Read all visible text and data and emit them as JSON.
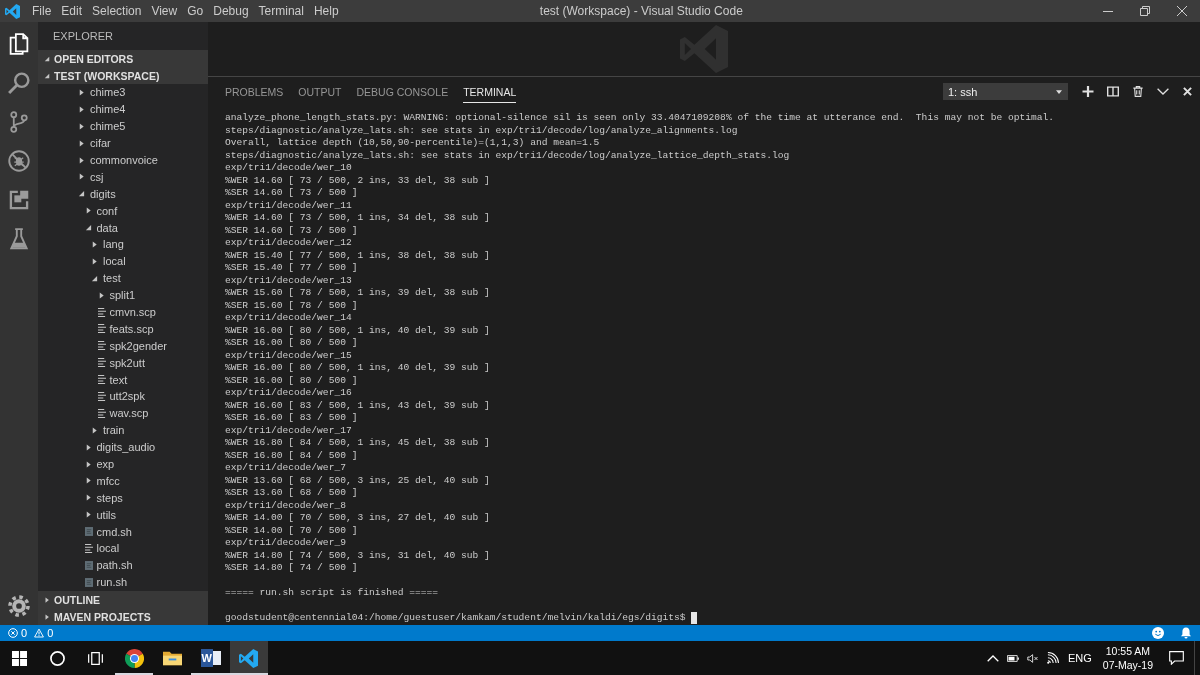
{
  "title_bar": {
    "menu": [
      "File",
      "Edit",
      "Selection",
      "View",
      "Go",
      "Debug",
      "Terminal",
      "Help"
    ],
    "title": "test (Workspace) - Visual Studio Code"
  },
  "activity_bar": {
    "items": [
      {
        "kind": "files",
        "selected": true
      },
      {
        "kind": "search",
        "selected": false
      },
      {
        "kind": "source-control",
        "selected": false
      },
      {
        "kind": "debug",
        "selected": false
      },
      {
        "kind": "extensions",
        "selected": false
      },
      {
        "kind": "test",
        "selected": false
      }
    ]
  },
  "sidebar": {
    "title": "EXPLORER",
    "sections": [
      {
        "title": "OPEN EDITORS",
        "expanded": true
      },
      {
        "title": "TEST (WORKSPACE)",
        "expanded": true,
        "tree": [
          {
            "name": "chime3",
            "kind": "folder",
            "expanded": false
          },
          {
            "name": "chime4",
            "kind": "folder",
            "expanded": false
          },
          {
            "name": "chime5",
            "kind": "folder",
            "expanded": false
          },
          {
            "name": "cifar",
            "kind": "folder",
            "expanded": false
          },
          {
            "name": "commonvoice",
            "kind": "folder",
            "expanded": false
          },
          {
            "name": "csj",
            "kind": "folder",
            "expanded": false
          },
          {
            "name": "digits",
            "kind": "folder",
            "expanded": true,
            "children": [
              {
                "name": "conf",
                "kind": "folder",
                "expanded": false
              },
              {
                "name": "data",
                "kind": "folder",
                "expanded": true,
                "children": [
                  {
                    "name": "lang",
                    "kind": "folder",
                    "expanded": false
                  },
                  {
                    "name": "local",
                    "kind": "folder",
                    "expanded": false
                  },
                  {
                    "name": "test",
                    "kind": "folder",
                    "expanded": true,
                    "children": [
                      {
                        "name": "split1",
                        "kind": "folder",
                        "expanded": false
                      },
                      {
                        "name": "cmvn.scp",
                        "kind": "text"
                      },
                      {
                        "name": "feats.scp",
                        "kind": "text"
                      },
                      {
                        "name": "spk2gender",
                        "kind": "text"
                      },
                      {
                        "name": "spk2utt",
                        "kind": "text"
                      },
                      {
                        "name": "text",
                        "kind": "text"
                      },
                      {
                        "name": "utt2spk",
                        "kind": "text"
                      },
                      {
                        "name": "wav.scp",
                        "kind": "text"
                      }
                    ]
                  },
                  {
                    "name": "train",
                    "kind": "folder",
                    "expanded": false
                  }
                ]
              },
              {
                "name": "digits_audio",
                "kind": "folder",
                "expanded": false
              },
              {
                "name": "exp",
                "kind": "folder",
                "expanded": false
              },
              {
                "name": "mfcc",
                "kind": "folder",
                "expanded": false
              },
              {
                "name": "steps",
                "kind": "folder",
                "expanded": false
              },
              {
                "name": "utils",
                "kind": "folder",
                "expanded": false
              },
              {
                "name": "cmd.sh",
                "kind": "script"
              },
              {
                "name": "local",
                "kind": "text"
              },
              {
                "name": "path.sh",
                "kind": "script"
              },
              {
                "name": "run.sh",
                "kind": "script"
              }
            ]
          }
        ]
      },
      {
        "title": "OUTLINE",
        "expanded": false
      },
      {
        "title": "MAVEN PROJECTS",
        "expanded": false
      }
    ]
  },
  "panel": {
    "tabs": [
      {
        "label": "PROBLEMS",
        "selected": false
      },
      {
        "label": "OUTPUT",
        "selected": false
      },
      {
        "label": "DEBUG CONSOLE",
        "selected": false
      },
      {
        "label": "TERMINAL",
        "selected": true
      }
    ],
    "terminal_select": {
      "value": "1: ssh"
    },
    "terminal": {
      "lines": [
        "analyze_phone_length_stats.py: WARNING: optional-silence sil is seen only 33.4047109208% of the time at utterance end.  This may not be optimal.",
        "steps/diagnostic/analyze_lats.sh: see stats in exp/tri1/decode/log/analyze_alignments.log",
        "Overall, lattice depth (10,50,90-percentile)=(1,1,3) and mean=1.5",
        "steps/diagnostic/analyze_lats.sh: see stats in exp/tri1/decode/log/analyze_lattice_depth_stats.log",
        "exp/tri1/decode/wer_10",
        "%WER 14.60 [ 73 / 500, 2 ins, 33 del, 38 sub ]",
        "%SER 14.60 [ 73 / 500 ]",
        "exp/tri1/decode/wer_11",
        "%WER 14.60 [ 73 / 500, 1 ins, 34 del, 38 sub ]",
        "%SER 14.60 [ 73 / 500 ]",
        "exp/tri1/decode/wer_12",
        "%WER 15.40 [ 77 / 500, 1 ins, 38 del, 38 sub ]",
        "%SER 15.40 [ 77 / 500 ]",
        "exp/tri1/decode/wer_13",
        "%WER 15.60 [ 78 / 500, 1 ins, 39 del, 38 sub ]",
        "%SER 15.60 [ 78 / 500 ]",
        "exp/tri1/decode/wer_14",
        "%WER 16.00 [ 80 / 500, 1 ins, 40 del, 39 sub ]",
        "%SER 16.00 [ 80 / 500 ]",
        "exp/tri1/decode/wer_15",
        "%WER 16.00 [ 80 / 500, 1 ins, 40 del, 39 sub ]",
        "%SER 16.00 [ 80 / 500 ]",
        "exp/tri1/decode/wer_16",
        "%WER 16.60 [ 83 / 500, 1 ins, 43 del, 39 sub ]",
        "%SER 16.60 [ 83 / 500 ]",
        "exp/tri1/decode/wer_17",
        "%WER 16.80 [ 84 / 500, 1 ins, 45 del, 38 sub ]",
        "%SER 16.80 [ 84 / 500 ]",
        "exp/tri1/decode/wer_7",
        "%WER 13.60 [ 68 / 500, 3 ins, 25 del, 40 sub ]",
        "%SER 13.60 [ 68 / 500 ]",
        "exp/tri1/decode/wer_8",
        "%WER 14.00 [ 70 / 500, 3 ins, 27 del, 40 sub ]",
        "%SER 14.00 [ 70 / 500 ]",
        "exp/tri1/decode/wer_9",
        "%WER 14.80 [ 74 / 500, 3 ins, 31 del, 40 sub ]",
        "%SER 14.80 [ 74 / 500 ]"
      ],
      "footer": "===== run.sh script is finished =====",
      "prompt": "goodstudent@centennial04:/home/guestuser/kamkam/student/melvin/kaldi/egs/digits$"
    }
  },
  "status_bar": {
    "errors": "0",
    "warnings": "0"
  },
  "taskbar": {
    "items": [
      {
        "kind": "start",
        "running": false,
        "selected": false
      },
      {
        "kind": "search",
        "running": false,
        "selected": false
      },
      {
        "kind": "task-view",
        "running": false,
        "selected": false
      },
      {
        "kind": "browser",
        "running": true,
        "selected": false
      },
      {
        "kind": "folder",
        "running": false,
        "selected": false
      },
      {
        "kind": "word",
        "letter": "W",
        "running": true,
        "selected": false
      },
      {
        "kind": "editor",
        "running": true,
        "selected": true
      }
    ],
    "tray": {
      "language": "ENG",
      "time": "10:55 AM",
      "date": "07-May-19"
    }
  }
}
